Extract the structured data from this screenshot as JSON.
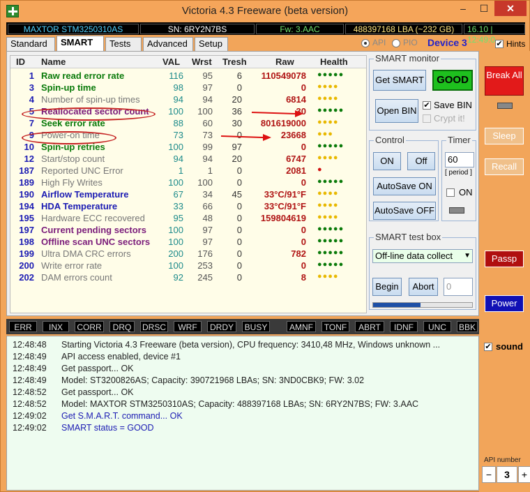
{
  "window": {
    "title": "Victoria 4.3 Freeware (beta version)",
    "min": "–",
    "max": "☐",
    "close": "✕"
  },
  "infobar": {
    "model": "MAXTOR STM3250310AS",
    "sn": "SN: 6RY2N7BS",
    "fw": "Fw: 3.AAC",
    "lba": "488397168 LBA (~232 GB)",
    "time": "16.10 | 12:49:0"
  },
  "tabs": [
    "Standard",
    "SMART",
    "Tests",
    "Advanced",
    "Setup"
  ],
  "mode": {
    "api_label": "API",
    "pio_label": "PIO",
    "selected": "API",
    "device": "Device 3"
  },
  "hints": {
    "label": "Hints",
    "checked": true
  },
  "table": {
    "headers": [
      "ID",
      "Name",
      "VAL",
      "Wrst",
      "Tresh",
      "Raw",
      "Health"
    ],
    "rows": [
      {
        "id": "1",
        "name": "Raw read error rate",
        "val": "116",
        "wrst": "95",
        "tresh": "6",
        "raw": "110549078",
        "health": "●●●●●",
        "name_color": "#0a7a0a",
        "health_color": "#0a7a0a",
        "bold": true
      },
      {
        "id": "3",
        "name": "Spin-up time",
        "val": "98",
        "wrst": "97",
        "tresh": "0",
        "raw": "0",
        "health": "●●●●",
        "name_color": "#0a7a0a",
        "health_color": "#e8b800",
        "bold": true
      },
      {
        "id": "4",
        "name": "Number of spin-up times",
        "val": "94",
        "wrst": "94",
        "tresh": "20",
        "raw": "6814",
        "health": "●●●●",
        "name_color": "#777777",
        "health_color": "#e8b800",
        "bold": false
      },
      {
        "id": "5",
        "name": "Reallocated sector count",
        "val": "100",
        "wrst": "100",
        "tresh": "36",
        "raw": "30",
        "health": "●●●●●",
        "name_color": "#7a1b7a",
        "health_color": "#0a7a0a",
        "bold": true
      },
      {
        "id": "7",
        "name": "Seek error rate",
        "val": "88",
        "wrst": "60",
        "tresh": "30",
        "raw": "801619000",
        "health": "●●●●",
        "name_color": "#0a7a0a",
        "health_color": "#e8b800",
        "bold": true
      },
      {
        "id": "9",
        "name": "Power-on time",
        "val": "73",
        "wrst": "73",
        "tresh": "0",
        "raw": "23668",
        "health": "●●●",
        "name_color": "#777777",
        "health_color": "#e8b800",
        "bold": false
      },
      {
        "id": "10",
        "name": "Spin-up retries",
        "val": "100",
        "wrst": "99",
        "tresh": "97",
        "raw": "0",
        "health": "●●●●●",
        "name_color": "#0a7a0a",
        "health_color": "#0a7a0a",
        "bold": true
      },
      {
        "id": "12",
        "name": "Start/stop count",
        "val": "94",
        "wrst": "94",
        "tresh": "20",
        "raw": "6747",
        "health": "●●●●",
        "name_color": "#777777",
        "health_color": "#e8b800",
        "bold": false
      },
      {
        "id": "187",
        "name": "Reported UNC Error",
        "val": "1",
        "wrst": "1",
        "tresh": "0",
        "raw": "2081",
        "health": "●",
        "name_color": "#777777",
        "health_color": "#d01010",
        "bold": false
      },
      {
        "id": "189",
        "name": "High Fly Writes",
        "val": "100",
        "wrst": "100",
        "tresh": "0",
        "raw": "0",
        "health": "●●●●●",
        "name_color": "#777777",
        "health_color": "#0a7a0a",
        "bold": false
      },
      {
        "id": "190",
        "name": "Airflow Temperature",
        "val": "67",
        "wrst": "34",
        "tresh": "45",
        "raw": "33°C/91°F",
        "health": "●●●●",
        "name_color": "#1b1bb3",
        "health_color": "#e8b800",
        "bold": true
      },
      {
        "id": "194",
        "name": "HDA Temperature",
        "val": "33",
        "wrst": "66",
        "tresh": "0",
        "raw": "33°C/91°F",
        "health": "●●●●",
        "name_color": "#1b1bb3",
        "health_color": "#e8b800",
        "bold": true
      },
      {
        "id": "195",
        "name": "Hardware ECC recovered",
        "val": "95",
        "wrst": "48",
        "tresh": "0",
        "raw": "159804619",
        "health": "●●●●",
        "name_color": "#777777",
        "health_color": "#e8b800",
        "bold": false
      },
      {
        "id": "197",
        "name": "Current pending sectors",
        "val": "100",
        "wrst": "97",
        "tresh": "0",
        "raw": "0",
        "health": "●●●●●",
        "name_color": "#7a1b7a",
        "health_color": "#0a7a0a",
        "bold": true
      },
      {
        "id": "198",
        "name": "Offline scan UNC sectors",
        "val": "100",
        "wrst": "97",
        "tresh": "0",
        "raw": "0",
        "health": "●●●●●",
        "name_color": "#7a1b7a",
        "health_color": "#0a7a0a",
        "bold": true
      },
      {
        "id": "199",
        "name": "Ultra DMA CRC errors",
        "val": "200",
        "wrst": "176",
        "tresh": "0",
        "raw": "782",
        "health": "●●●●●",
        "name_color": "#777777",
        "health_color": "#0a7a0a",
        "bold": false
      },
      {
        "id": "200",
        "name": "Write error rate",
        "val": "100",
        "wrst": "253",
        "tresh": "0",
        "raw": "0",
        "health": "●●●●●",
        "name_color": "#777777",
        "health_color": "#0a7a0a",
        "bold": false
      },
      {
        "id": "202",
        "name": "DAM errors count",
        "val": "92",
        "wrst": "245",
        "tresh": "0",
        "raw": "8",
        "health": "●●●●",
        "name_color": "#777777",
        "health_color": "#e8b800",
        "bold": false
      }
    ]
  },
  "smart_monitor": {
    "label": "SMART monitor",
    "get_smart": "Get SMART",
    "status": "GOOD",
    "open_bin": "Open BIN",
    "save_bin": "Save BIN",
    "save_bin_checked": true,
    "crypt": "Crypt it!"
  },
  "control": {
    "label": "Control",
    "on": "ON",
    "off": "Off",
    "autosave_on": "AutoSave ON",
    "autosave_off": "AutoSave OFF"
  },
  "timer": {
    "label": "Timer",
    "value": "60",
    "period": "[ period ]",
    "on_label": "ON"
  },
  "test_box": {
    "label": "SMART test box",
    "selected": "Off-line data collect",
    "begin": "Begin",
    "abort": "Abort",
    "count": "0",
    "progress": 0.48
  },
  "side": {
    "break_all": "Break All",
    "sleep": "Sleep",
    "recall": "Recall",
    "passp": "Passp",
    "power": "Power",
    "sound": "sound",
    "sound_checked": true,
    "api_number_label": "API number",
    "api_number": "3"
  },
  "flags": [
    "ERR",
    "INX",
    "CORR",
    "DRQ",
    "DRSC",
    "WRF",
    "DRDY",
    "BUSY",
    "AMNF",
    "TONF",
    "ABRT",
    "IDNF",
    "UNC",
    "BBK"
  ],
  "log": [
    {
      "time": "12:48:48",
      "msg": "Starting Victoria 4.3 Freeware (beta version), CPU frequency: 3410,48 MHz, Windows unknown ...",
      "blue": false
    },
    {
      "time": "12:48:49",
      "msg": "API access enabled, device #1",
      "blue": false
    },
    {
      "time": "12:48:49",
      "msg": "Get passport... OK",
      "blue": false
    },
    {
      "time": "12:48:49",
      "msg": "Model: ST3200826AS; Capacity: 390721968 LBAs; SN: 3ND0CBK9; FW: 3.02",
      "blue": false
    },
    {
      "time": "12:48:52",
      "msg": "Get passport... OK",
      "blue": false
    },
    {
      "time": "12:48:52",
      "msg": "Model: MAXTOR STM3250310AS; Capacity: 488397168 LBAs; SN: 6RY2N7BS; FW: 3.AAC",
      "blue": false
    },
    {
      "time": "12:49:02",
      "msg": "Get S.M.A.R.T. command... OK",
      "blue": true
    },
    {
      "time": "12:49:02",
      "msg": "SMART status = GOOD",
      "blue": true
    }
  ]
}
